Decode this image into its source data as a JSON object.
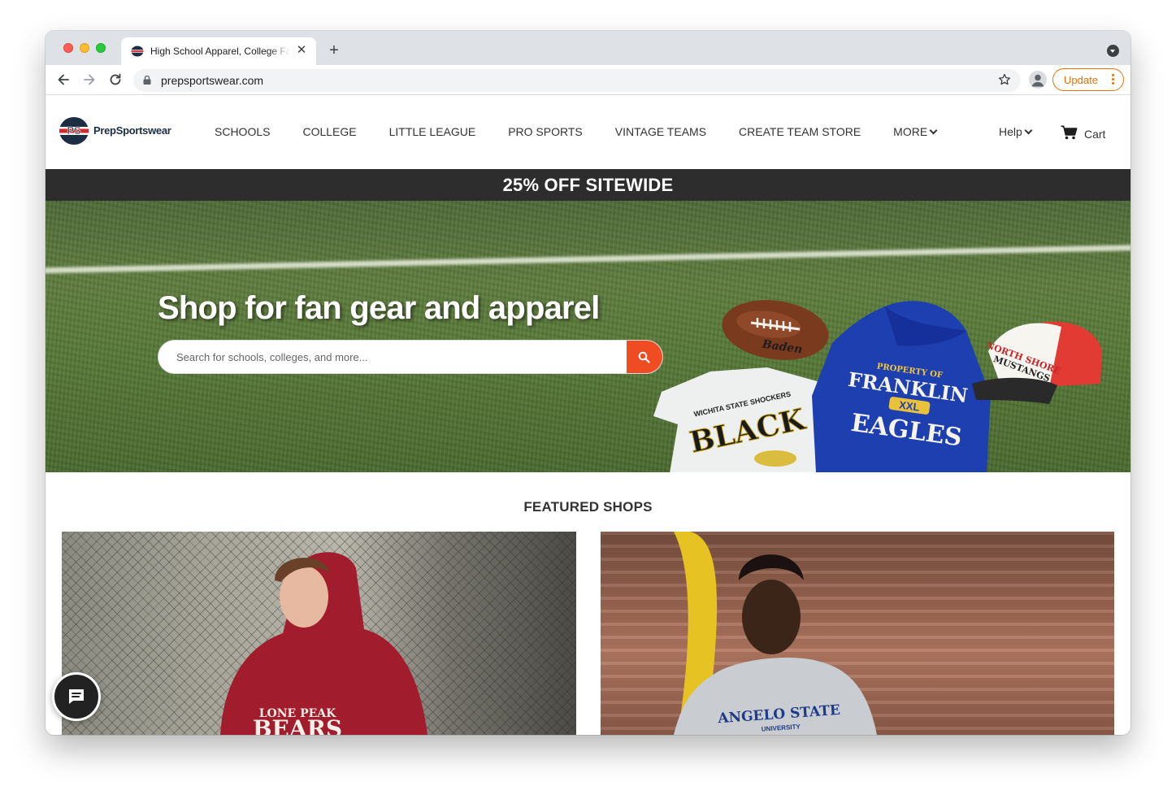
{
  "browser": {
    "tab_title": "High School Apparel, College Fan Gear",
    "url": "prepsportswear.com",
    "update_label": "Update"
  },
  "site": {
    "logo_text": "PrepSportswear",
    "nav": [
      "SCHOOLS",
      "COLLEGE",
      "LITTLE LEAGUE",
      "PRO SPORTS",
      "VINTAGE TEAMS",
      "CREATE TEAM STORE"
    ],
    "more_label": "MORE",
    "help_label": "Help",
    "cart_label": "Cart"
  },
  "promo": {
    "text": "25% OFF SITEWIDE"
  },
  "hero": {
    "title": "Shop for fan gear and apparel",
    "search_placeholder": "Search for schools, colleges, and more..."
  },
  "featured": {
    "title": "FEATURED SHOPS",
    "shops": [
      {
        "shirt_text_top": "LONE PEAK",
        "shirt_text_main": "BEARS"
      },
      {
        "shirt_text_top": "ANGELO STATE",
        "shirt_text_main": "UNIVERSITY"
      }
    ]
  },
  "hero_products": {
    "football_brand": "Baden",
    "tshirt_top": "WICHITA STATE SHOCKERS",
    "tshirt_main": "BLACK",
    "hoodie_top": "PROPERTY OF",
    "hoodie_line1": "FRANKLIN",
    "hoodie_badge": "XXL",
    "hoodie_line2": "EAGLES",
    "cap_line1": "NORTH SHORE",
    "cap_line2": "MUSTANGS"
  },
  "colors": {
    "accent_orange": "#ef4c23",
    "promo_bg": "#2d2d2d",
    "update_orange": "#e8710a"
  }
}
